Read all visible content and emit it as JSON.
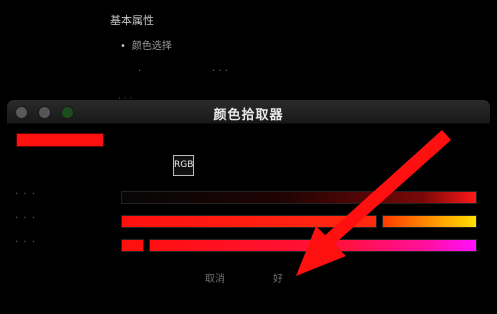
{
  "background_doc": {
    "heading": "基本属性",
    "bullet": "颜色选择",
    "sub1": "·",
    "sub2": "· · ·",
    "sub3": "· · ·"
  },
  "window": {
    "title": "颜色拾取器",
    "traffic_lights": [
      "close",
      "minimize",
      "zoom"
    ]
  },
  "picker": {
    "current_color": "#ff1010",
    "mode": "RGB",
    "channels": [
      {
        "label": "· · ·"
      },
      {
        "label": "· · ·"
      },
      {
        "label": "· · ·"
      }
    ]
  },
  "buttons": {
    "cancel": "取消",
    "ok": "好"
  },
  "colors": {
    "accent_red": "#ff1010",
    "window_bg": "#000000",
    "titlebar": "#222222"
  }
}
